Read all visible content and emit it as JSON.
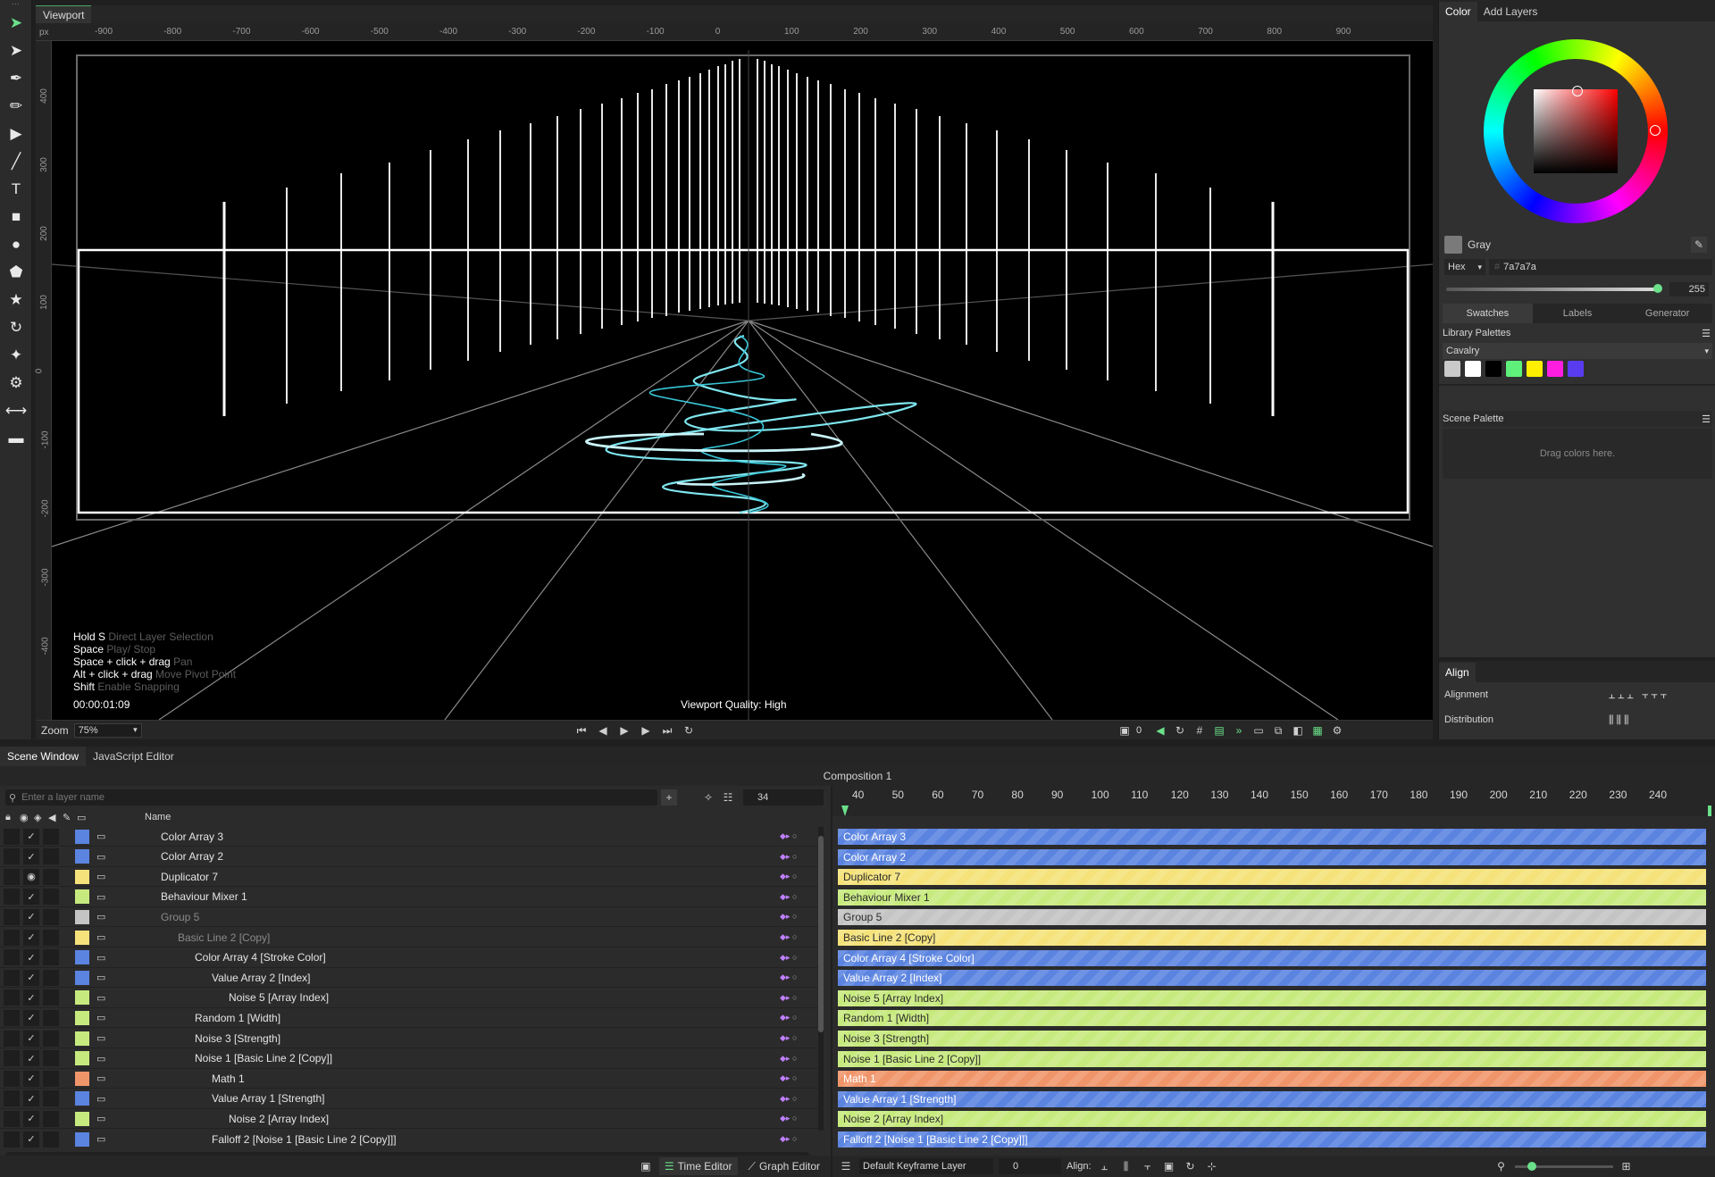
{
  "toolbar": {
    "tools": [
      {
        "name": "selection-tool-icon",
        "glyph": "➤",
        "active": true
      },
      {
        "name": "direct-select-tool-icon",
        "glyph": "➤",
        "active": false
      },
      {
        "name": "pen-tool-icon",
        "glyph": "✒",
        "active": false
      },
      {
        "name": "pencil-tool-icon",
        "glyph": "✏",
        "active": false
      },
      {
        "name": "camera-tool-icon",
        "glyph": "▶",
        "active": false
      },
      {
        "name": "line-tool-icon",
        "glyph": "╱",
        "active": false
      },
      {
        "name": "text-tool-icon",
        "glyph": "T",
        "active": false
      },
      {
        "name": "rectangle-tool-icon",
        "glyph": "■",
        "active": false
      },
      {
        "name": "ellipse-tool-icon",
        "glyph": "●",
        "active": false
      },
      {
        "name": "polygon-tool-icon",
        "glyph": "⬟",
        "active": false
      },
      {
        "name": "star-tool-icon",
        "glyph": "★",
        "active": false
      },
      {
        "name": "arc-tool-icon",
        "glyph": "↻",
        "active": false
      },
      {
        "name": "spark-tool-icon",
        "glyph": "✦",
        "active": false
      },
      {
        "name": "gear-tool-icon",
        "glyph": "⚙",
        "active": false
      },
      {
        "name": "resize-tool-icon",
        "glyph": "⟷",
        "active": false
      },
      {
        "name": "pill-tool-icon",
        "glyph": "▬",
        "active": false
      }
    ]
  },
  "viewport": {
    "tab": "Viewport",
    "ruler_unit": "px",
    "ruler_x": [
      "-900",
      "-800",
      "-700",
      "-600",
      "-500",
      "-400",
      "-300",
      "-200",
      "-100",
      "0",
      "100",
      "200",
      "300",
      "400",
      "500",
      "600",
      "700",
      "800",
      "900"
    ],
    "ruler_y": [
      "400",
      "300",
      "200",
      "100",
      "0",
      "-100",
      "-200",
      "-300",
      "-400"
    ],
    "hints": [
      {
        "key": "Hold S",
        "desc": "Direct Layer Selection"
      },
      {
        "key": "Space",
        "desc": "Play/ Stop"
      },
      {
        "key": "Space + click + drag",
        "desc": "Pan"
      },
      {
        "key": "Alt + click + drag",
        "desc": "Move Pivot Point"
      },
      {
        "key": "Shift",
        "desc": "Enable Snapping"
      }
    ],
    "timecode": "00:00:01:09",
    "quality": "Viewport Quality: High",
    "zoom_label": "Zoom",
    "zoom_value": "75%",
    "frame_value": "0"
  },
  "color_panel": {
    "tabs": [
      "Color",
      "Add Layers"
    ],
    "color_name": "Gray",
    "hex_mode": "Hex",
    "hex_value": "7a7a7a",
    "alpha": "255",
    "subtabs": [
      "Swatches",
      "Labels",
      "Generator"
    ],
    "library_title": "Library Palettes",
    "palette_name": "Cavalry",
    "palette_colors": [
      "#c9c9c9",
      "#ffffff",
      "#000000",
      "#5ef07a",
      "#ffee00",
      "#ff1ee0",
      "#5a3cf0"
    ],
    "scene_palette_title": "Scene Palette",
    "scene_palette_hint": "Drag colors here.",
    "current_color": "#7a7a7a"
  },
  "align_panel": {
    "tab": "Align",
    "alignment_label": "Alignment",
    "distribution_label": "Distribution"
  },
  "bottom": {
    "tabs": [
      "Scene Window",
      "JavaScript Editor"
    ],
    "composition": "Composition 1",
    "search_placeholder": "Enter a layer name",
    "frame_field": "34",
    "name_header": "Name",
    "time_editor": "Time Editor",
    "graph_editor": "Graph Editor",
    "keyframe_layer": "Default Keyframe Layer",
    "kf_value": "0",
    "align_label": "Align:",
    "timeline_ticks": [
      "40",
      "50",
      "60",
      "70",
      "80",
      "90",
      "100",
      "110",
      "120",
      "130",
      "140",
      "150",
      "160",
      "170",
      "180",
      "190",
      "200",
      "210",
      "220",
      "230",
      "240"
    ]
  },
  "layers": [
    {
      "name": "Color Array 3",
      "color": "#5b84e0",
      "indent": 0,
      "bar": "#5b84e0",
      "dark": false,
      "dim": false
    },
    {
      "name": "Color Array 2",
      "color": "#5b84e0",
      "indent": 0,
      "bar": "#5b84e0",
      "dark": false,
      "dim": false
    },
    {
      "name": "Duplicator 7",
      "color": "#f5e27a",
      "indent": 0,
      "bar": "#f5e27a",
      "dark": true,
      "dim": false
    },
    {
      "name": "Behaviour Mixer 1",
      "color": "#c7ea7e",
      "indent": 0,
      "bar": "#c7ea7e",
      "dark": true,
      "dim": false
    },
    {
      "name": "Group 5",
      "color": "#c4c4c4",
      "indent": 0,
      "bar": "#c4c4c4",
      "dark": true,
      "dim": true
    },
    {
      "name": "Basic Line 2 [Copy]",
      "color": "#f5e27a",
      "indent": 1,
      "bar": "#f5e27a",
      "dark": true,
      "dim": true
    },
    {
      "name": "Color Array 4 [Stroke Color]",
      "color": "#5b84e0",
      "indent": 2,
      "bar": "#5b84e0",
      "dark": false,
      "dim": false
    },
    {
      "name": "Value Array 2 [Index]",
      "color": "#5b84e0",
      "indent": 3,
      "bar": "#5b84e0",
      "dark": false,
      "dim": false
    },
    {
      "name": "Noise 5 [Array Index]",
      "color": "#c7ea7e",
      "indent": 4,
      "bar": "#c7ea7e",
      "dark": true,
      "dim": false
    },
    {
      "name": "Random 1 [Width]",
      "color": "#c7ea7e",
      "indent": 2,
      "bar": "#c7ea7e",
      "dark": true,
      "dim": false
    },
    {
      "name": "Noise 3 [Strength]",
      "color": "#c7ea7e",
      "indent": 2,
      "bar": "#c7ea7e",
      "dark": true,
      "dim": false
    },
    {
      "name": "Noise 1 [Basic Line 2 [Copy]]",
      "color": "#c7ea7e",
      "indent": 2,
      "bar": "#c7ea7e",
      "dark": true,
      "dim": false
    },
    {
      "name": "Math 1",
      "color": "#f0956a",
      "indent": 3,
      "bar": "#f0956a",
      "dark": false,
      "dim": false
    },
    {
      "name": "Value Array 1 [Strength]",
      "color": "#5b84e0",
      "indent": 3,
      "bar": "#5b84e0",
      "dark": false,
      "dim": false
    },
    {
      "name": "Noise 2 [Array Index]",
      "color": "#c7ea7e",
      "indent": 4,
      "bar": "#c7ea7e",
      "dark": true,
      "dim": false
    },
    {
      "name": "Falloff 2 [Noise 1 [Basic Line 2 [Copy]]]",
      "color": "#5b84e0",
      "indent": 3,
      "bar": "#5b84e0",
      "dark": false,
      "dim": false
    }
  ]
}
